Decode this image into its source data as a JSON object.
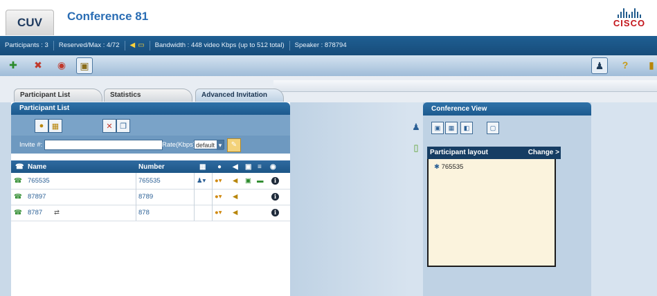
{
  "header": {
    "app_tab": "CUV",
    "conference_title": "Conference 81",
    "logo_text": "CISCO"
  },
  "status": {
    "participants": "Participants : 3",
    "reserved": "Reserved/Max : 4/72",
    "bandwidth": "Bandwidth : 448 video Kbps (up to 512 total)",
    "speaker": "Speaker : 878794"
  },
  "tabs": [
    {
      "label": "Participant List",
      "active": false
    },
    {
      "label": "Statistics",
      "active": false
    },
    {
      "label": "Advanced Invitation",
      "active": true
    }
  ],
  "participant_panel": {
    "title": "Participant List",
    "invite_label": "Invite #:",
    "invite_value": "",
    "rate_label": "Rate(Kbps):",
    "rate_value": "default",
    "columns": {
      "name": "Name",
      "number": "Number"
    }
  },
  "participants": [
    {
      "name": "765535",
      "number": "765535"
    },
    {
      "name": "87897",
      "number": "8789"
    },
    {
      "name": "8787",
      "number": "878"
    }
  ],
  "conference_view": {
    "title": "Conference View",
    "layout_title": "Participant layout",
    "change_label": "Change >",
    "layout_entry": "765535"
  },
  "icons": {
    "toolbar_left": [
      "add-participant-icon",
      "remove-participant-icon",
      "mute-icon",
      "video-icon"
    ],
    "toolbar_right": [
      "user-status-icon",
      "help-icon",
      "exit-icon"
    ]
  },
  "colors": {
    "brand_blue": "#1d5a8e",
    "title_blue": "#2a6db4",
    "cisco_red": "#c3141a",
    "layout_bg": "#fbf3dd"
  }
}
